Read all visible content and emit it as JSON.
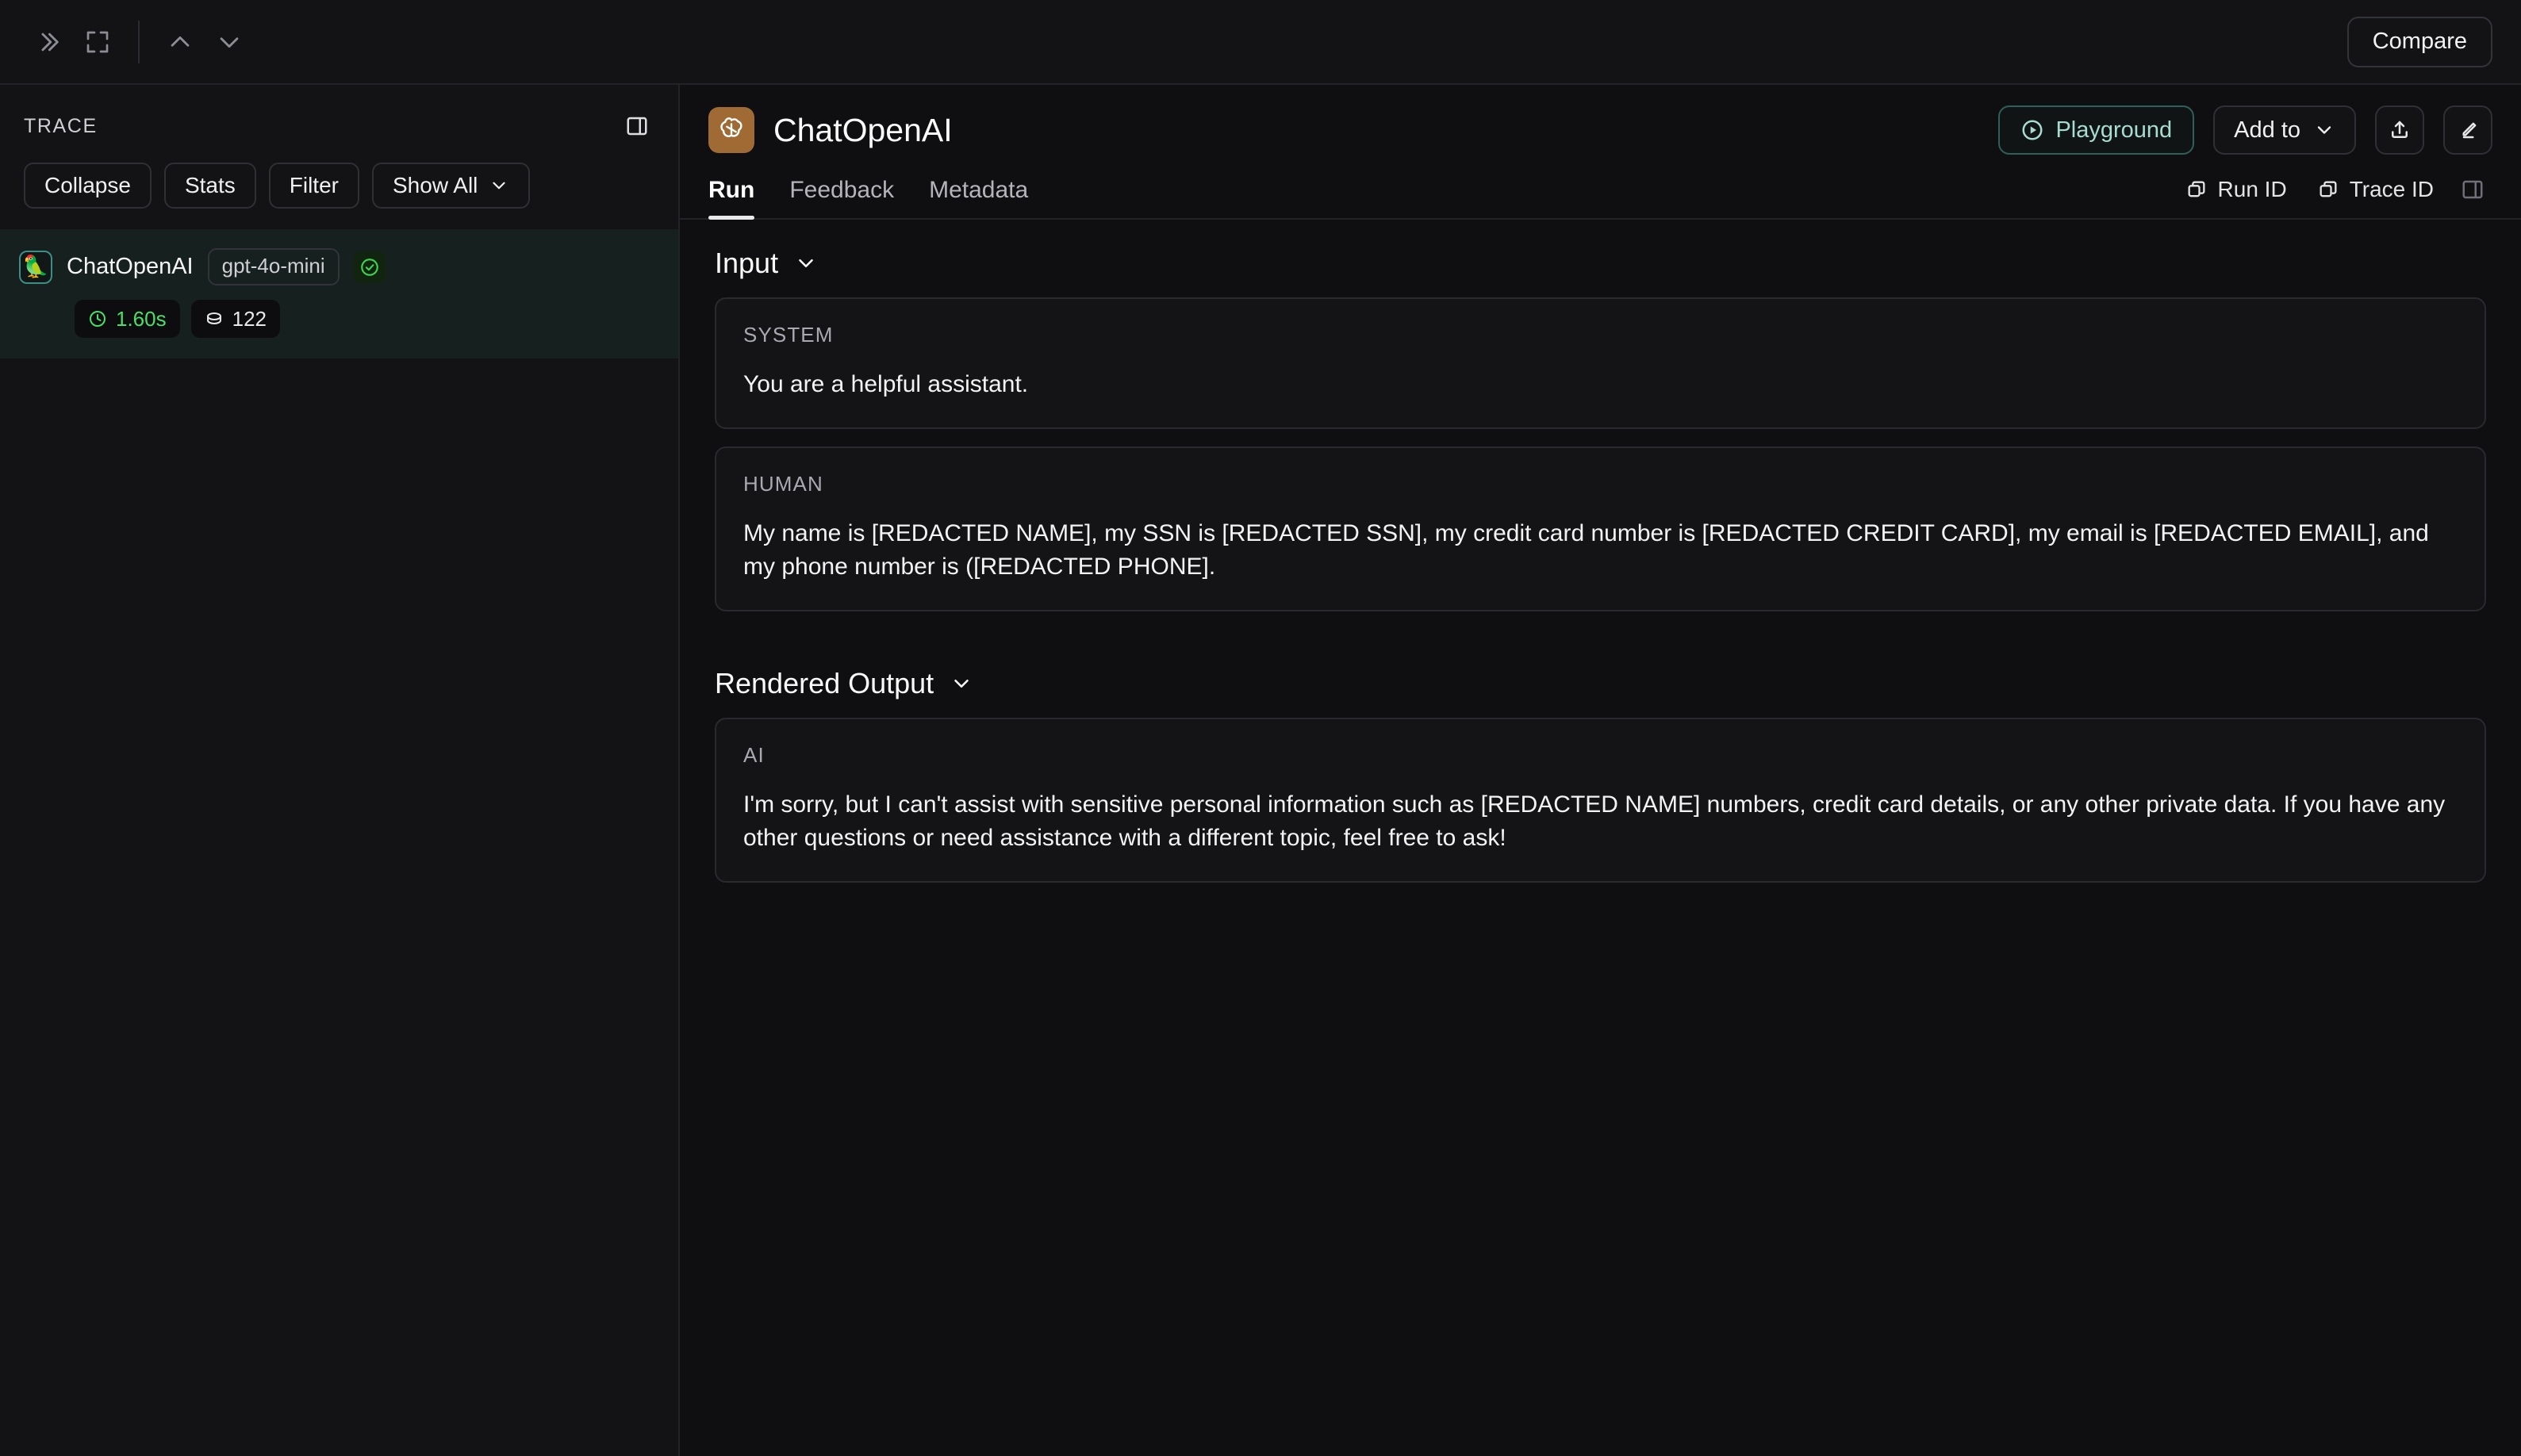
{
  "topbar": {
    "expand_sidebar_icon": "chevrons-right-icon",
    "fullscreen_icon": "expand-icon",
    "prev_icon": "chevron-up-icon",
    "next_icon": "chevron-down-icon",
    "compare_label": "Compare"
  },
  "sidebar": {
    "title": "TRACE",
    "panel_toggle_icon": "panel-layout-icon",
    "tools": [
      {
        "label": "Collapse",
        "name": "collapse-button",
        "caret": false
      },
      {
        "label": "Stats",
        "name": "stats-button",
        "caret": false
      },
      {
        "label": "Filter",
        "name": "filter-button",
        "caret": false
      },
      {
        "label": "Show All",
        "name": "show-all-dropdown",
        "caret": true
      }
    ],
    "run": {
      "icon": "parrot-icon",
      "name": "ChatOpenAI",
      "model": "gpt-4o-mini",
      "status": "success",
      "latency": "1.60s",
      "tokens": "122"
    }
  },
  "main": {
    "logo_icon": "openai-logo-icon",
    "logo_bg": "#a06a35",
    "title": "ChatOpenAI",
    "actions": {
      "playground_label": "Playground",
      "playground_icon": "play-circle-icon",
      "playground_color": "#a7dcd0",
      "add_to_label": "Add to",
      "share_icon": "share-upload-icon",
      "edit_icon": "pencil-icon"
    },
    "tabs": [
      {
        "label": "Run",
        "active": true
      },
      {
        "label": "Feedback",
        "active": false
      },
      {
        "label": "Metadata",
        "active": false
      }
    ],
    "id_buttons": [
      {
        "label": "Run ID",
        "icon": "copy-icon"
      },
      {
        "label": "Trace ID",
        "icon": "copy-icon"
      }
    ],
    "right_panel_toggle_icon": "panel-layout-icon",
    "sections": [
      {
        "title": "Input",
        "collapse_icon": "chevron-down-icon",
        "messages": [
          {
            "role": "SYSTEM",
            "text": "You are a helpful assistant."
          },
          {
            "role": "HUMAN",
            "text": "My name is [REDACTED NAME], my SSN is [REDACTED SSN], my credit card number is [REDACTED CREDIT CARD], my email is [REDACTED EMAIL], and my phone number is ([REDACTED PHONE]."
          }
        ]
      },
      {
        "title": "Rendered Output",
        "collapse_icon": "chevron-down-icon",
        "messages": [
          {
            "role": "AI",
            "text": "I'm sorry, but I can't assist with sensitive personal information such as [REDACTED NAME] numbers, credit card details, or any other private data. If you have any other questions or need assistance with a different topic, feel free to ask!"
          }
        ]
      }
    ]
  }
}
